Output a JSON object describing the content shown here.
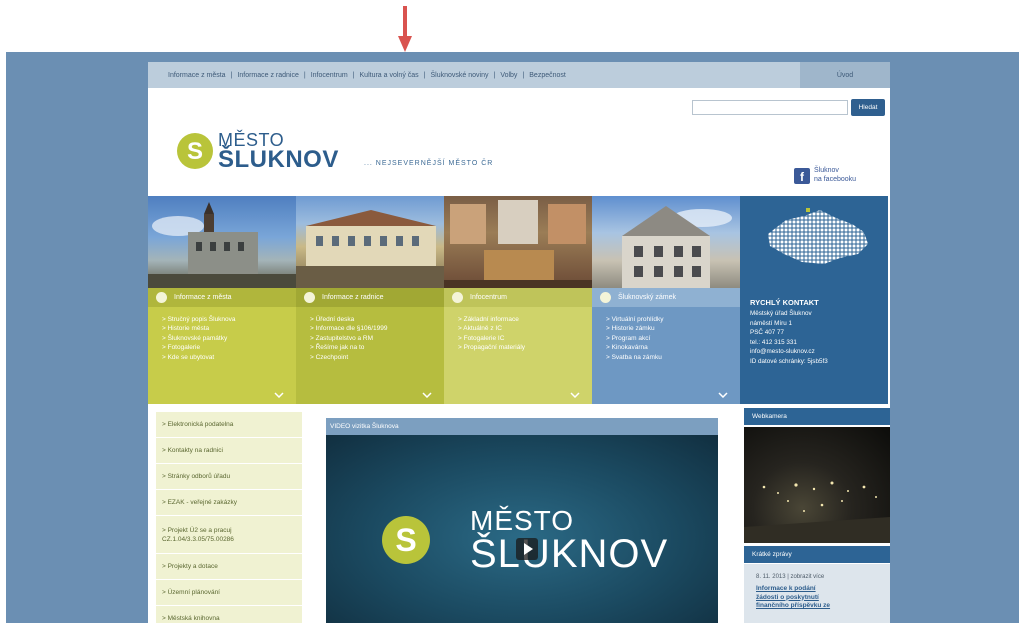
{
  "annotation": {
    "arrow_color": "#d9534f"
  },
  "colors": {
    "frame": "#6b8fb3",
    "brand_blue": "#2d6495",
    "lime": "#c7cc4a"
  },
  "topnav": {
    "items": [
      "Informace z města",
      "Informace z radnice",
      "Infocentrum",
      "Kultura a volný čas",
      "Šluknovské noviny",
      "Volby",
      "Bezpečnost"
    ],
    "separator": "|",
    "home": "Úvod"
  },
  "search": {
    "value": "",
    "button": "Hledat"
  },
  "logo": {
    "line1": "MĚSTO",
    "line2": "ŠLUKNOV",
    "tagline": "... NEJSEVERNĚJŠÍ MĚSTO ČR",
    "icon": "s-logo-icon"
  },
  "facebook": {
    "line1": "Šluknov",
    "line2": "na facebooku",
    "icon": "facebook-icon"
  },
  "panels": [
    {
      "title": "Informace z města",
      "items": [
        "> Stručný popis Šluknova",
        "> Historie města",
        "> Šluknovské památky",
        "> Fotogalerie",
        "> Kde se ubytovat"
      ]
    },
    {
      "title": "Informace z radnice",
      "items": [
        "> Úřední deska",
        "> Informace dle §106/1999",
        "> Zastupitelstvo a RM",
        "> Řešíme jak na to",
        "> Czechpoint"
      ]
    },
    {
      "title": "Infocentrum",
      "items": [
        "> Základní informace",
        "> Aktuálně z IC",
        "> Fotogalerie IC",
        "> Propagační materiály"
      ]
    },
    {
      "title": "Šluknovský zámek",
      "items": [
        "> Virtuální prohlídky",
        "> Historie zámku",
        "> Program akcí",
        "> Kinokavárna",
        "> Svatba na zámku"
      ]
    }
  ],
  "contact": {
    "title": "RYCHLÝ KONTAKT",
    "lines": [
      "Městský úřad Šluknov",
      "náměstí Míru 1",
      "PSČ 407 77",
      "tel.: 412 315 331",
      "info@mesto-sluknov.cz",
      "ID datové schránky: 5jsb5f3"
    ]
  },
  "left_menu": [
    "> Elektronická podatelna",
    "> Kontakty na radnici",
    "> Stránky odborů úřadu",
    "> EZAK - veřejné zakázky",
    "> Projekt Ú2 se a pracuj CZ.1.04/3.3.05/75.00286",
    "> Projekty a dotace",
    "> Územní plánování",
    "> Městská knihovna"
  ],
  "video": {
    "title": "VIDEO vizitka Šluknova",
    "line1": "MĚSTO",
    "line2": "ŠLUKNOV"
  },
  "webcam": {
    "title": "Webkamera"
  },
  "news": {
    "title": "Krátké zprávy",
    "meta": "8. 11. 2013  |  zobrazit více",
    "headline": [
      "Informace k podání",
      "žádosti o poskytnutí",
      "finančního příspěvku ze"
    ]
  }
}
